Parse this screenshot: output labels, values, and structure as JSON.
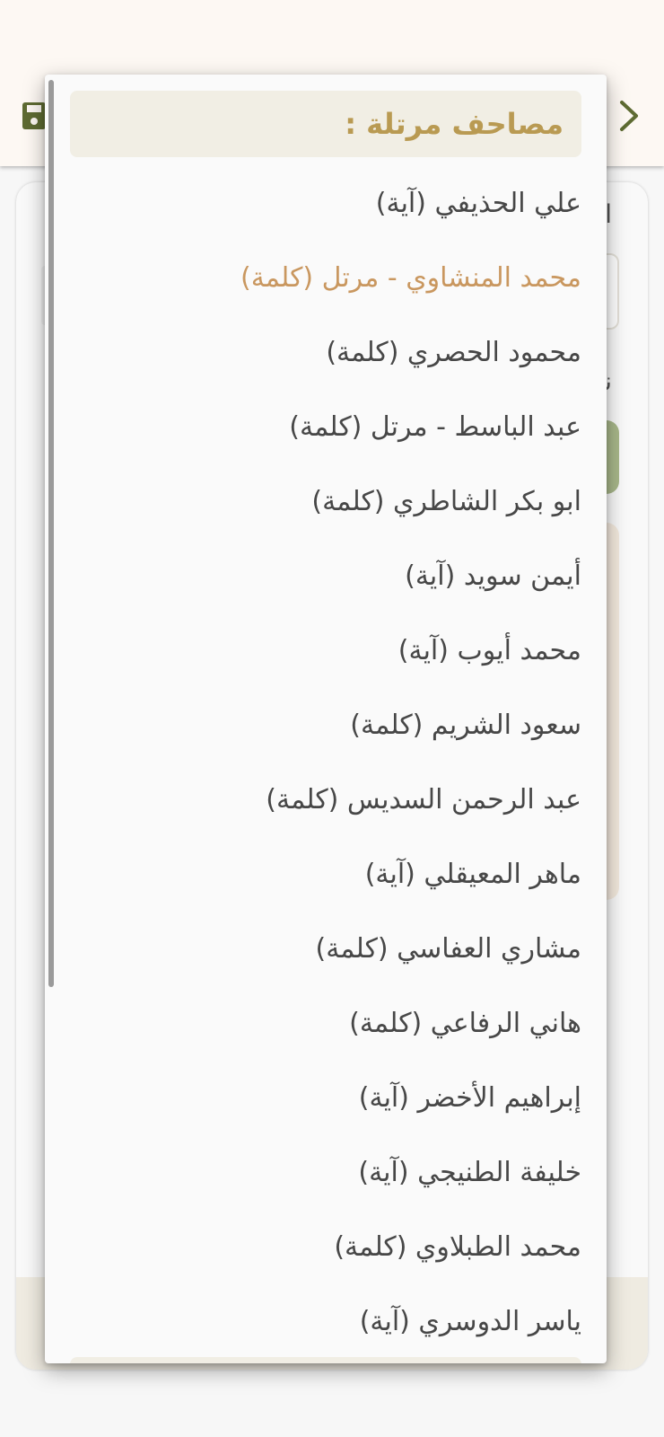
{
  "dropdown": {
    "group_header": "مصاحف مرتلة :",
    "selected_index": 1,
    "items": [
      "علي الحذيفي (آية)",
      "محمد المنشاوي - مرتل (كلمة)",
      "محمود الحصري (كلمة)",
      "عبد الباسط - مرتل (كلمة)",
      "ابو بكر الشاطري (كلمة)",
      "أيمن سويد (آية)",
      "محمد أيوب (آية)",
      "سعود الشريم (كلمة)",
      "عبد الرحمن السديس (كلمة)",
      "ماهر المعيقلي (آية)",
      "مشاري العفاسي (كلمة)",
      "هاني الرفاعي (كلمة)",
      "إبراهيم الأخضر (آية)",
      "خليفة الطنيجي (آية)",
      "محمد الطبلاوي (كلمة)",
      "ياسر الدوسري (آية)"
    ]
  },
  "background": {
    "label_1": "ا",
    "label_2": "نو"
  },
  "colors": {
    "header_bg": "#fdf8f3",
    "accent_gold": "#b99a52",
    "selected_text": "#c9975f",
    "icon_green": "#5e6b32"
  },
  "icons": {
    "save": "save-icon",
    "back": "chevron-right-icon"
  }
}
